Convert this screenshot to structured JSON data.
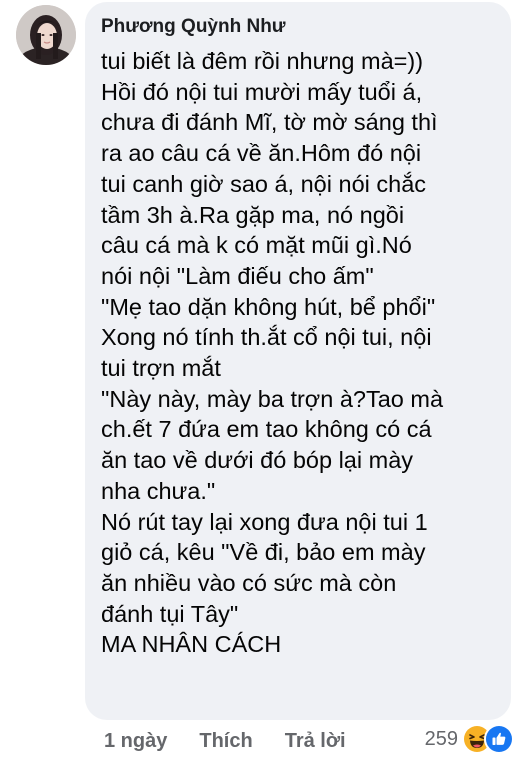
{
  "comment": {
    "author": "Phương Quỳnh Như",
    "lines": [
      "tui biết là đêm rồi nhưng mà=))",
      "Hồi đó nội tui mười mấy tuổi á,",
      "chưa đi đánh Mĩ, tờ mờ sáng thì",
      "ra ao câu cá về ăn.Hôm đó nội",
      "tui canh giờ sao á, nội nói chắc",
      "tầm 3h à.Ra gặp ma, nó ngồi",
      "câu cá mà k có mặt mũi gì.Nó",
      "nói nội \"Làm điếu cho ấm\"",
      "\"Mẹ tao dặn không hút, bể phổi\"",
      "Xong nó tính th.ắt cổ nội tui, nội",
      "tui trợn mắt",
      "\"Này này, mày ba trợn à?Tao mà",
      "ch.ết 7 đứa em tao không có cá",
      "ăn tao về dưới đó bóp lại mày",
      "nha chưa.\"",
      "Nó rút tay lại xong đưa nội tui 1",
      "giỏ cá, kêu \"Về đi, bảo em mày",
      "ăn nhiều vào có sức mà còn",
      "đánh tụi Tây\"",
      "MA NHÂN CÁCH"
    ]
  },
  "actions": {
    "time": "1 ngày",
    "like": "Thích",
    "reply": "Trả lời"
  },
  "reactions": {
    "count": "259",
    "icons": [
      "haha-reaction-icon",
      "like-reaction-icon"
    ],
    "colors": {
      "haha": "#f7b125",
      "like": "#1877f2"
    }
  }
}
